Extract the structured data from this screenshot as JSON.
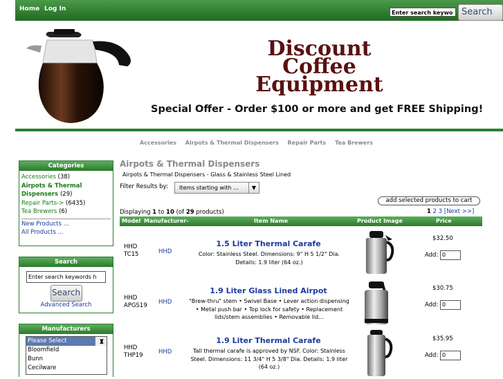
{
  "topbar": {
    "home": "Home",
    "login": "Log In",
    "search_value": "Enter search keywo",
    "search_btn": "Search"
  },
  "banner": {
    "line1": "Discount",
    "line2": "Coffee",
    "line3": "Equipment",
    "offer": "Special Offer - Order $100 or more and get FREE Shipping!"
  },
  "catnav": [
    "Accessories",
    "Airpots & Thermal Dispensers",
    "Repair Parts",
    "Tea Brewers"
  ],
  "categories": {
    "title": "Categories",
    "items": [
      {
        "label": "Accessories",
        "count": "(38)"
      },
      {
        "label": "Airpots & Thermal Dispensers",
        "count": "(29)"
      },
      {
        "label": "Repair Parts->",
        "count": "(6435)"
      },
      {
        "label": "Tea Brewers",
        "count": "(6)"
      }
    ],
    "new_products": "New Products ...",
    "all_products": "All Products ..."
  },
  "search_box": {
    "title": "Search",
    "input": "Enter search keywords h",
    "button": "Search",
    "advanced": "Advanced Search"
  },
  "manufacturers": {
    "title": "Manufacturers",
    "options": [
      "Please Select",
      "Bloomfield",
      "Bunn",
      "Cecilware"
    ]
  },
  "main": {
    "title": "Airpots & Thermal Dispensers",
    "subtitle": "Airpots & Thermal Dispensers - Glass & Stainless Steel Lined",
    "filter_label": "Filter Results by:",
    "filter_value": "Items starting with ...",
    "add_cart": "add selected products to cart",
    "display_pre": "Displaying ",
    "display_from": "1",
    "display_mid": " to ",
    "display_to": "10",
    "display_of": " (of ",
    "display_total": "29",
    "display_post": " products)",
    "pages": [
      "1",
      "2",
      "3"
    ],
    "next": "[Next >>]",
    "headers": [
      "Model",
      "Manufacturer-",
      "Item Name",
      "Product Image",
      "Price"
    ]
  },
  "products": [
    {
      "model": "HHD TC15",
      "mfr": "HHD",
      "name": "1.5 Liter Thermal Carafe",
      "desc": "Color: Stainless Steel. Dimensions: 9\" H 5 1/2\" Dia. Details: 1.9 liter (64 oz.)",
      "price": "$32.50",
      "add_label": "Add:",
      "qty": "0"
    },
    {
      "model": "HHD APGS19",
      "mfr": "HHD",
      "name": "1.9 Liter Glass Lined Airpot",
      "desc": "\"Brew-thru\" stem • Swivel Base • Lever action dispensing • Metal push bar • Top lock for safety • Replacement lids/stem assemblies • Removable lid...",
      "price": "$30.75",
      "add_label": "Add:",
      "qty": "0"
    },
    {
      "model": "HHD THP19",
      "mfr": "HHD",
      "name": "1.9 Liter Thermal Carafe",
      "desc": "Tall thermal carafe is approved by NSF. Color: Stainless Steel. Dimensions: 11 3/4\" H 5 3/8\" Dia. Details: 1.9 liter (64 oz.)",
      "price": "$35.95",
      "add_label": "Add:",
      "qty": "0"
    }
  ]
}
